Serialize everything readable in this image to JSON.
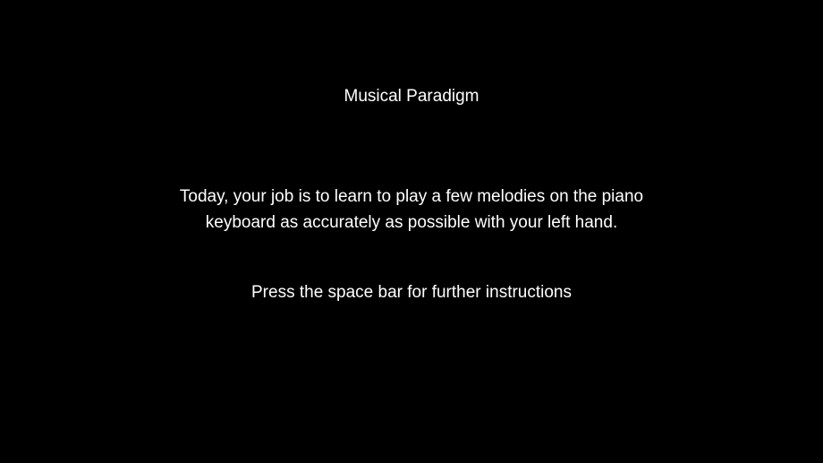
{
  "screen": {
    "background_color": "#000000",
    "text_color": "#ffffff",
    "title": "Musical Paradigm",
    "instructions": {
      "line1": "Today, your job is to learn to play a few melodies on the piano",
      "line2": "keyboard as accurately as possible with your left hand."
    },
    "prompt": "Press the space bar for further instructions"
  }
}
